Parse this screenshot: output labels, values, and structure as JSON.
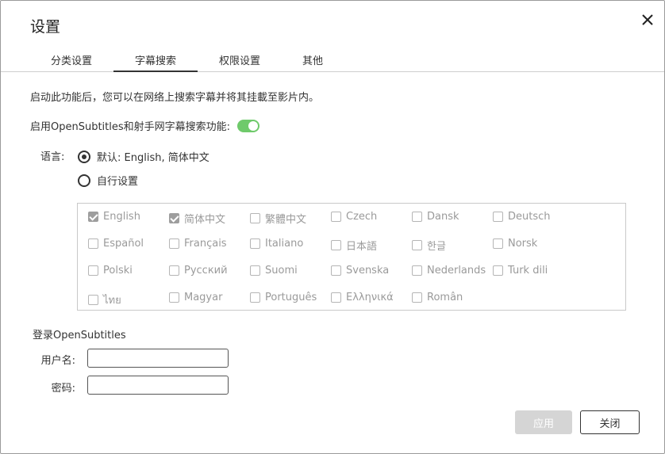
{
  "dialog": {
    "title": "设置",
    "close_icon": "close-icon"
  },
  "tabs": [
    {
      "label": "分类设置",
      "active": false
    },
    {
      "label": "字幕搜索",
      "active": true
    },
    {
      "label": "权限设置",
      "active": false
    },
    {
      "label": "其他",
      "active": false
    }
  ],
  "content": {
    "description": "启动此功能后，您可以在网络上搜索字幕并将其挂載至影片内。",
    "enable_label": "启用OpenSubtitles和射手网字幕搜索功能:",
    "enable_on": true,
    "language_label": "语言:",
    "radio_default": "默认: English, 简体中文",
    "radio_custom": "自行设置",
    "radio_selected": "default"
  },
  "languages": [
    {
      "label": "English",
      "checked": true
    },
    {
      "label": "简体中文",
      "checked": true
    },
    {
      "label": "繁體中文",
      "checked": false
    },
    {
      "label": "Czech",
      "checked": false
    },
    {
      "label": "Dansk",
      "checked": false
    },
    {
      "label": "Deutsch",
      "checked": false
    },
    {
      "label": "Español",
      "checked": false
    },
    {
      "label": "Français",
      "checked": false
    },
    {
      "label": "Italiano",
      "checked": false
    },
    {
      "label": "日本語",
      "checked": false
    },
    {
      "label": "한글",
      "checked": false
    },
    {
      "label": "Norsk",
      "checked": false
    },
    {
      "label": "Polski",
      "checked": false
    },
    {
      "label": "Русский",
      "checked": false
    },
    {
      "label": "Suomi",
      "checked": false
    },
    {
      "label": "Svenska",
      "checked": false
    },
    {
      "label": "Nederlands",
      "checked": false
    },
    {
      "label": "Turk dili",
      "checked": false
    },
    {
      "label": "ไทย",
      "checked": false
    },
    {
      "label": "Magyar",
      "checked": false
    },
    {
      "label": "Português",
      "checked": false
    },
    {
      "label": "Ελληνικά",
      "checked": false
    },
    {
      "label": "Român",
      "checked": false
    }
  ],
  "login": {
    "title": "登录OpenSubtitles",
    "username_label": "用户名:",
    "username_value": "",
    "password_label": "密码:",
    "password_value": ""
  },
  "buttons": {
    "apply": "应用",
    "close": "关闭"
  },
  "colors": {
    "toggle_on": "#6fca6b",
    "apply_disabled": "#d5d5d5"
  }
}
